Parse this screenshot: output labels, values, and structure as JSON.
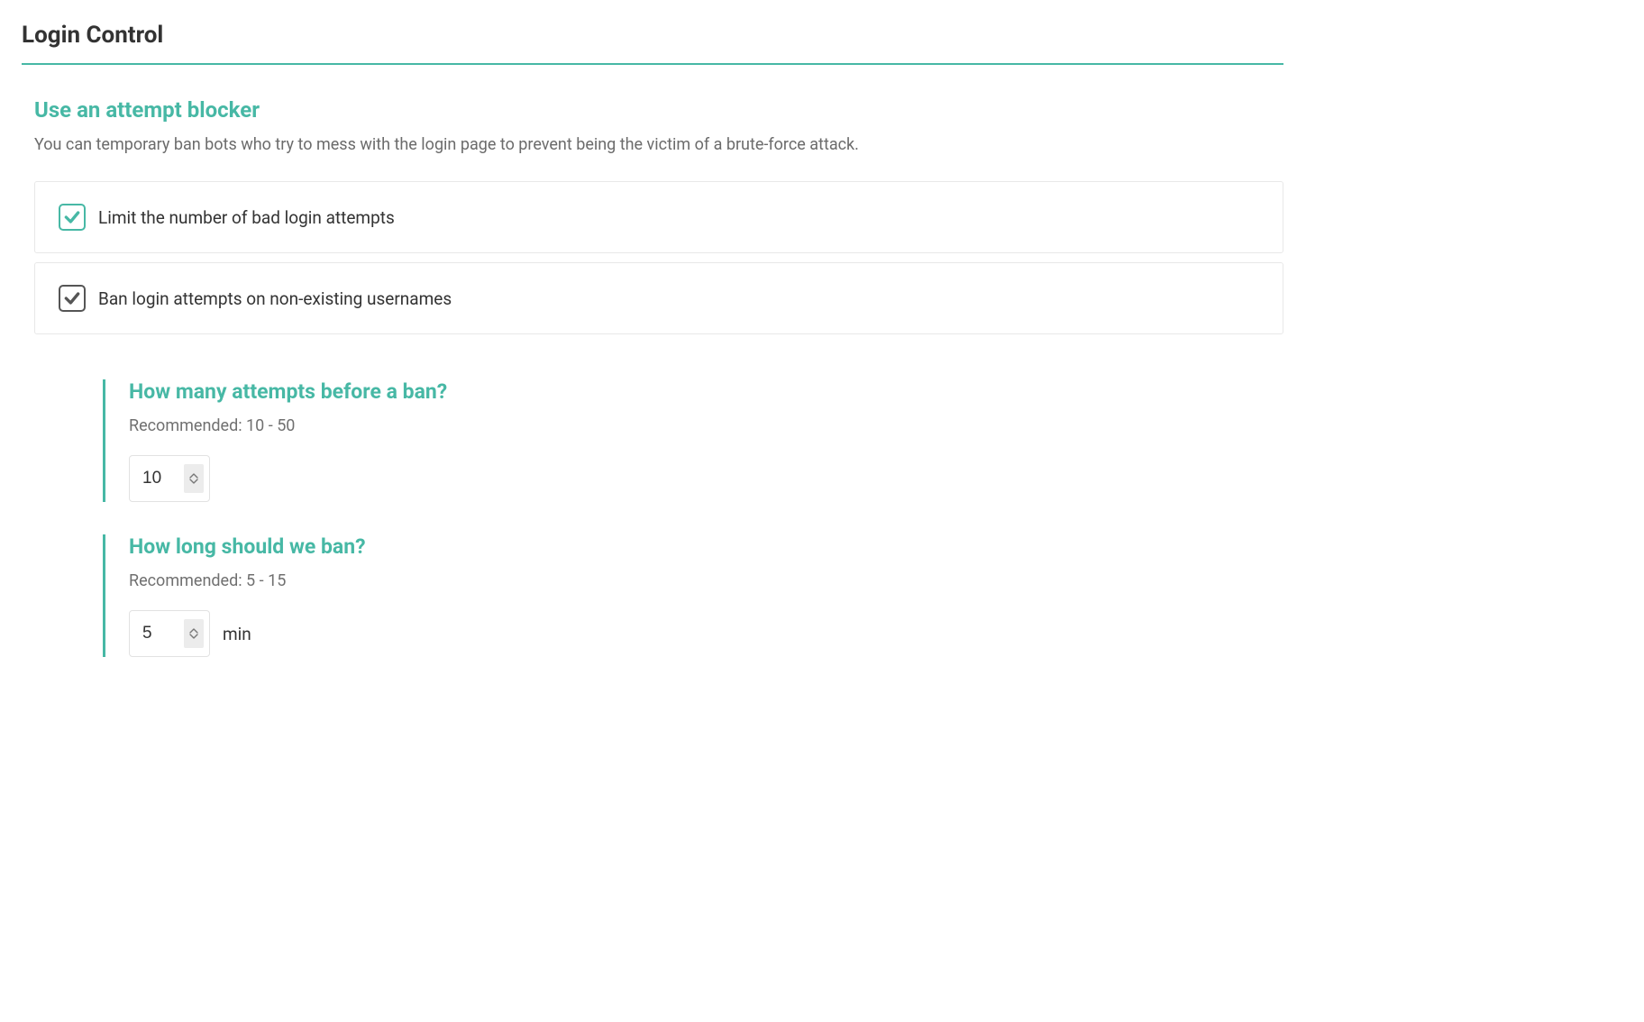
{
  "page": {
    "title": "Login Control"
  },
  "section": {
    "title": "Use an attempt blocker",
    "description": "You can temporary ban bots who try to mess with the login page to prevent being the victim of a brute-force attack."
  },
  "checkboxes": {
    "limit_attempts": {
      "label": "Limit the number of bad login attempts",
      "checked": true
    },
    "ban_nonexistent": {
      "label": "Ban login attempts on non-existing usernames",
      "checked": true
    }
  },
  "attempts_before_ban": {
    "title": "How many attempts before a ban?",
    "recommended": "Recommended: 10 - 50",
    "value": "10"
  },
  "ban_duration": {
    "title": "How long should we ban?",
    "recommended": "Recommended: 5 - 15",
    "value": "5",
    "unit": "min"
  },
  "colors": {
    "accent": "#47b8a5",
    "text": "#333333",
    "muted": "#6b6b6b"
  }
}
